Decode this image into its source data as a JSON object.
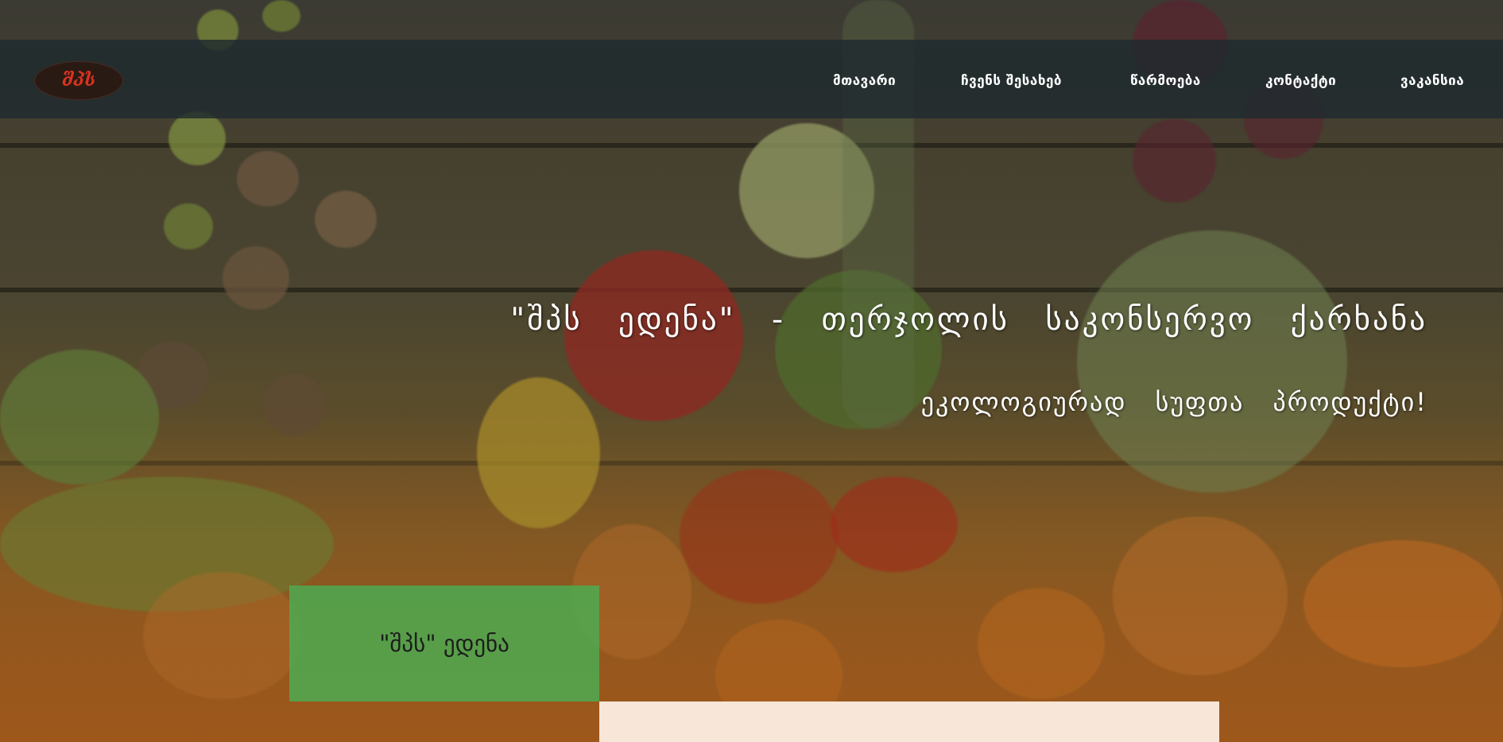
{
  "colors": {
    "navbar_bg": "#1e2a2e",
    "nav_text": "#ffffff",
    "hero_text": "#ffffff",
    "tab_green": "#50a850",
    "panel_cream": "#f8e6d8",
    "logo_red": "#d8331f"
  },
  "logo": {
    "text": "შპს",
    "icon": "company-logo"
  },
  "nav": {
    "items": [
      {
        "label": "მთავარი"
      },
      {
        "label": "ჩვენს შესახებ"
      },
      {
        "label": "წარმოება"
      },
      {
        "label": "კონტაქტი"
      },
      {
        "label": "ვაკანსია"
      }
    ]
  },
  "hero": {
    "title": "\"შპს ედენა\" - თერჯოლის საკონსერვო ქარხანა",
    "subtitle": "ეკოლოგიურად სუფთა პროდუქტი!"
  },
  "tabs": {
    "company_tab": "\"შპს\" ედენა"
  }
}
